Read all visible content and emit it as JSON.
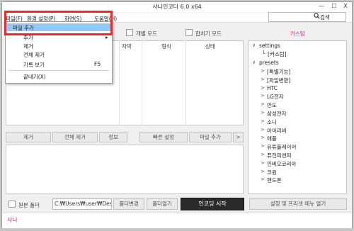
{
  "window": {
    "title": "샤나인코더 6.0 x64",
    "minimize": "—",
    "maximize": "☐",
    "close": "X"
  },
  "menu": {
    "file": "파일(F)",
    "settings": "환경 설정(P)",
    "screen": "화면(S)",
    "help": "도움말(H)"
  },
  "search": {
    "icon": "search-icon",
    "label": "검색",
    "value": ""
  },
  "toolbar": {
    "individual_mode": "개별 모드",
    "merge_mode": "합치기 모드"
  },
  "custom_label": "커스텀",
  "list": {
    "columns": [
      "자막",
      "형식",
      "상태"
    ]
  },
  "file_menu": {
    "items": [
      "파일 추가",
      "추가",
      "제거",
      "전체 제거",
      "기록 보기",
      "끝내기(X)"
    ],
    "submenu_arrow": "▸",
    "shortcut": "F5"
  },
  "tree": {
    "settings_root": "settings",
    "settings_child": "[커스텀]",
    "presets_root": "presets",
    "presets": [
      "[특별기능]",
      "[파일변환]",
      "HTC",
      "LG전자",
      "만도",
      "삼성전자",
      "소니",
      "아이리버",
      "애플",
      "유튜플레이어",
      "퓨전피앤피",
      "인비오코리아",
      "코원",
      "핸드폰"
    ]
  },
  "buttons": {
    "remove": "제거",
    "remove_all": "전체 제거",
    "info": "정보",
    "quick_settings": "빠른 설정",
    "add_file": "파일 추가",
    "more": ">"
  },
  "bottom": {
    "source_folder_label": "원본 폴더",
    "path_value": "C:₩Users₩user₩Desk",
    "change_folder": "폴더변경",
    "open_folder": "폴더열기",
    "start_encoding": "인코딩 시작",
    "settings_preset_menu": "설정 및 프리셋 메뉴 열기"
  },
  "status": {
    "text": "샤나"
  }
}
